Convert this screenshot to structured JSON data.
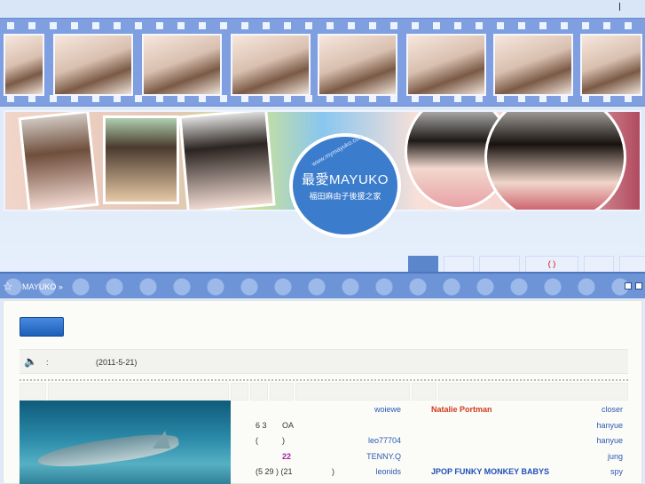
{
  "banner": {
    "logo_title": "最愛MAYUKO",
    "logo_subtitle": "福田麻由子後援之家",
    "logo_url": "www.mymayuko.com"
  },
  "tabs": [
    {
      "label": ""
    },
    {
      "label": ""
    },
    {
      "label": ""
    },
    {
      "label": "(  )"
    },
    {
      "label": ""
    },
    {
      "label": ""
    }
  ],
  "breadcrumb": "MAYUKO »",
  "notice": {
    "colon": ":",
    "date": "(2011-5-21)"
  },
  "list": [
    {
      "left1": "",
      "left2": "",
      "mid": "woiewe",
      "center": "Natalie Portman",
      "center_style": "red",
      "right": "closer"
    },
    {
      "left1": "6 3",
      "left2": "OA",
      "mid": "",
      "center": "",
      "center_style": "",
      "right": "hanyue"
    },
    {
      "left1": "(",
      "left2": ")",
      "mid": "leo77704",
      "center": "",
      "center_style": "",
      "right": "hanyue"
    },
    {
      "left1": "",
      "left2": "22",
      "mid": "TENNY.Q",
      "center": "",
      "center_style": "",
      "right": "jung"
    },
    {
      "left1": "(5 29 ) (21",
      "left2": ")",
      "mid": "leonids",
      "center": "JPOP      FUNKY MONKEY BABYS",
      "center_style": "blue",
      "right": "spy"
    }
  ],
  "colors": {
    "accent": "#6d94d6",
    "highlight_red": "#d23b1c",
    "highlight_blue": "#2050b8"
  }
}
